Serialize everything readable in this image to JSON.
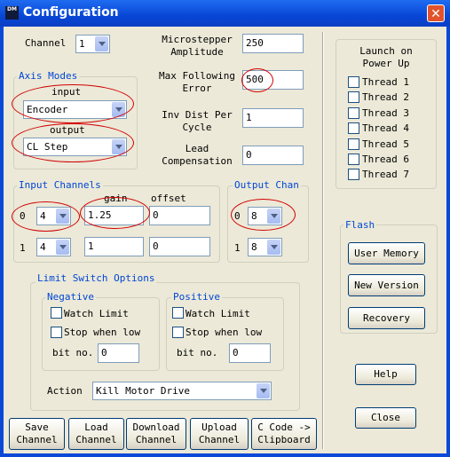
{
  "window": {
    "title": "Configuration",
    "icon_text": "DM"
  },
  "channel": {
    "label": "Channel",
    "value": "1"
  },
  "axis_modes": {
    "title": "Axis Modes",
    "input_label": "input",
    "input_value": "Encoder",
    "output_label": "output",
    "output_value": "CL Step"
  },
  "params": {
    "microstepper_label": "Microstepper\nAmplitude",
    "microstepper_value": "250",
    "max_following_label": "Max Following\nError",
    "max_following_value": "500",
    "inv_dist_label": "Inv Dist Per\nCycle",
    "inv_dist_value": "1",
    "lead_comp_label": "Lead\nCompensation",
    "lead_comp_value": "0"
  },
  "input_channels": {
    "title": "Input Channels",
    "gain_header": "gain",
    "offset_header": "offset",
    "rows": [
      {
        "index": "0",
        "channel": "4",
        "gain": "1.25",
        "offset": "0"
      },
      {
        "index": "1",
        "channel": "4",
        "gain": "1",
        "offset": "0"
      }
    ]
  },
  "output_channels": {
    "title": "Output Chan",
    "rows": [
      {
        "index": "0",
        "channel": "8"
      },
      {
        "index": "1",
        "channel": "8"
      }
    ]
  },
  "limit_switch": {
    "title": "Limit Switch Options",
    "negative": {
      "title": "Negative",
      "watch_label": "Watch Limit",
      "stop_label": "Stop when low",
      "bit_label": "bit no.",
      "bit_value": "0"
    },
    "positive": {
      "title": "Positive",
      "watch_label": "Watch Limit",
      "stop_label": "Stop when low",
      "bit_label": "bit no.",
      "bit_value": "0"
    },
    "action_label": "Action",
    "action_value": "Kill Motor Drive"
  },
  "launch": {
    "title": "Launch on\nPower Up",
    "threads": [
      "Thread 1",
      "Thread 2",
      "Thread 3",
      "Thread 4",
      "Thread 5",
      "Thread 6",
      "Thread 7"
    ]
  },
  "flash": {
    "title": "Flash",
    "user_memory": "User Memory",
    "new_version": "New Version",
    "recovery": "Recovery"
  },
  "side_buttons": {
    "help": "Help",
    "close": "Close"
  },
  "bottom_buttons": {
    "save": "Save\nChannel",
    "load": "Load\nChannel",
    "download": "Download\nChannel",
    "upload": "Upload\nChannel",
    "ccode": "C Code ->\nClipboard"
  },
  "annotation_color": "#d10000"
}
